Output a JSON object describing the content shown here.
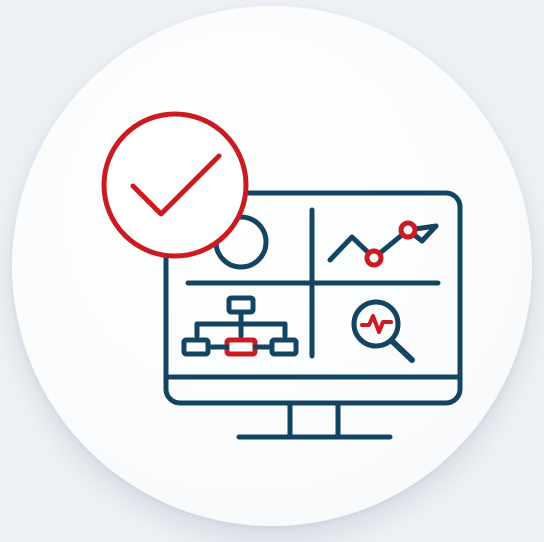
{
  "colors": {
    "background": "#eef2f6",
    "disc": "#ffffff",
    "primary": "#134563",
    "accent": "#cc1a22"
  },
  "icons": {
    "check_badge": "check-circle-icon",
    "monitor": "monitor-icon",
    "line_chart": "line-chart-icon",
    "hierarchy": "org-chart-icon",
    "magnifier": "magnifier-pulse-icon",
    "pie_circle": "circle-chart-icon"
  }
}
